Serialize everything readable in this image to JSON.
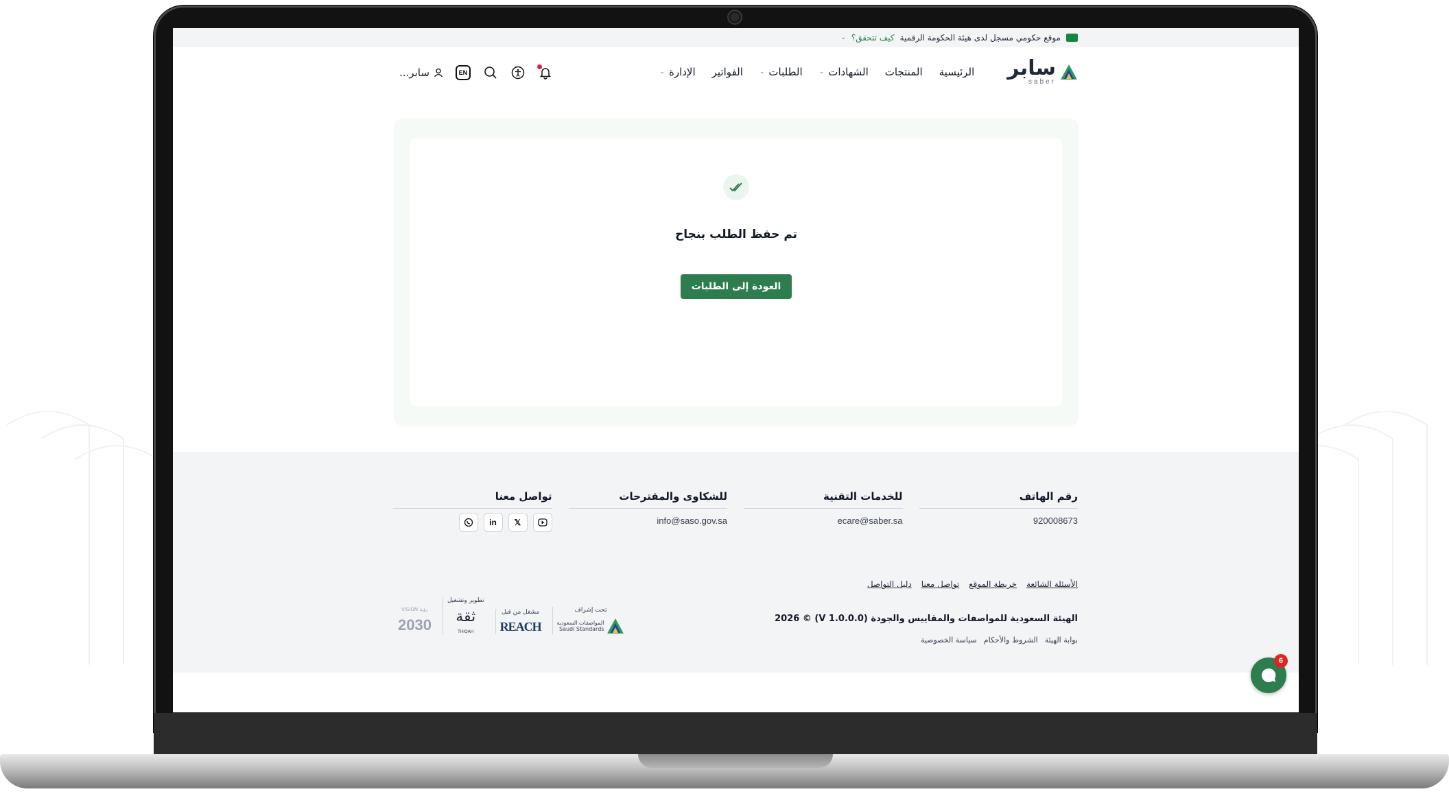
{
  "gov_bar": {
    "text": "موقع حكومي مسجل لدى هيئة الحكومة الرقمية",
    "link": "كيف تتحقق؟"
  },
  "header": {
    "brand": "سابر",
    "brand_sub": "saber",
    "nav": [
      {
        "label": "الرئيسية"
      },
      {
        "label": "المنتجات"
      },
      {
        "label": "الشهادات"
      },
      {
        "label": "الطلبات"
      },
      {
        "label": "الفواتير"
      },
      {
        "label": "الإدارة"
      }
    ],
    "lang": "EN",
    "user": "سابر..."
  },
  "main": {
    "title": "تم حفظ الطلب بنجاح",
    "button": "العودة إلى الطلبات"
  },
  "footer": {
    "cols": [
      {
        "title": "رقم الهاتف",
        "value": "920008673"
      },
      {
        "title": "للخدمات التقنية",
        "value": "ecare@saber.sa"
      },
      {
        "title": "للشكاوى والمقترحات",
        "value": "info@saso.gov.sa"
      },
      {
        "title": "تواصل معنا"
      }
    ],
    "links": [
      "الأسئلة الشائعة",
      "خريطة الموقع",
      "تواصل معنا",
      "دليل التواصل"
    ],
    "copyright": "الهيئة السعودية للمواصفات والمقاييس والجودة (V 1.0.0.0) © 2026",
    "sublinks": [
      "بوابة الهيئة",
      "الشروط والأحكام",
      "سياسة الخصوصية"
    ],
    "partners": {
      "supervision": "تحت إشراف",
      "saso_ar": "المواصفات السعودية",
      "saso_en": "Saudi Standards",
      "operated": "مشغل من قبل",
      "reach": "REACH",
      "developed": "تطوير وتشغيل",
      "thiqah": "ثقة",
      "thiqah_en": "THIQAH",
      "vision_label": "VISION رؤية",
      "vision": "2030"
    }
  },
  "chat": {
    "badge": "6"
  },
  "colors": {
    "primary": "#2e7d4f",
    "badge": "#dc2626",
    "footer_bg": "#f3f4f6"
  }
}
